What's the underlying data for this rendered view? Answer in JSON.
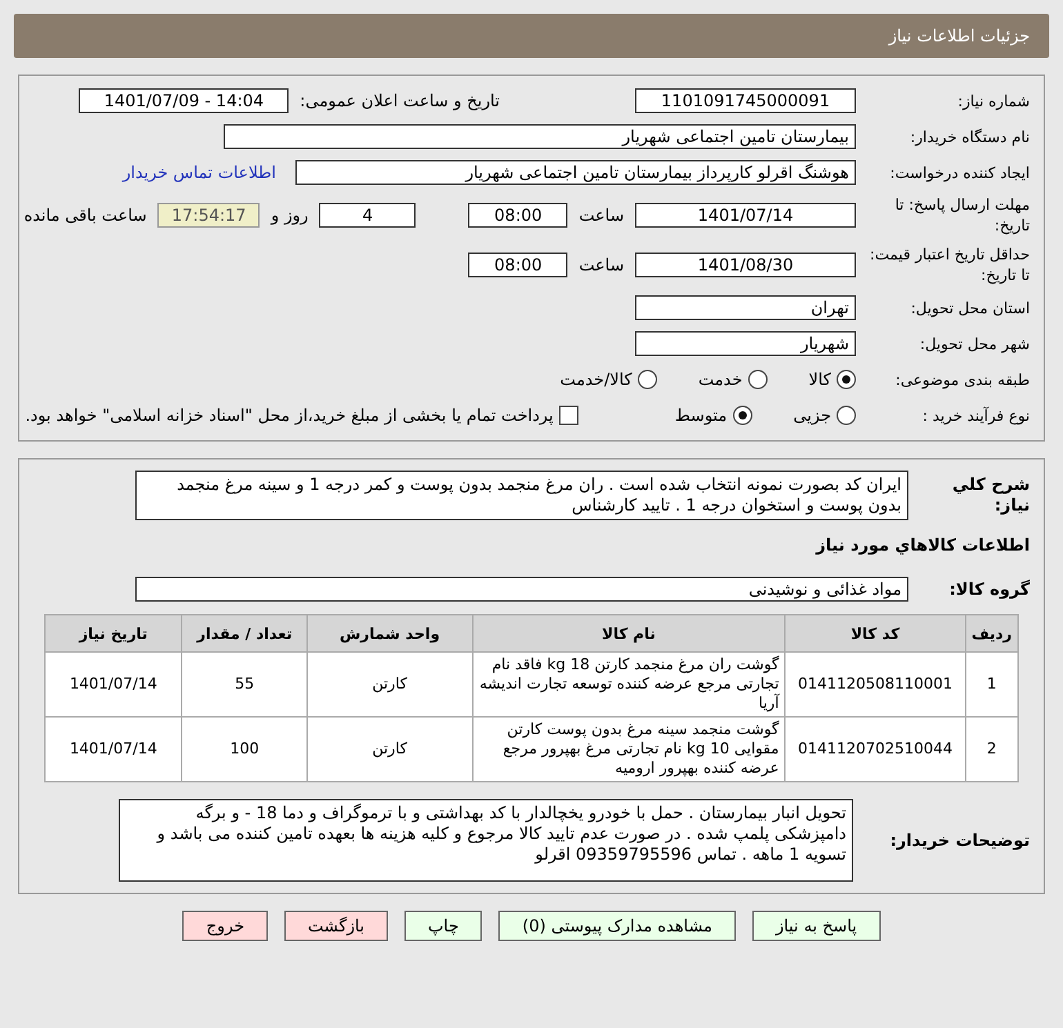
{
  "header": {
    "title": "جزئیات اطلاعات نیاز"
  },
  "need_number": {
    "label": "شماره نیاز:",
    "value": "1101091745000091"
  },
  "announce": {
    "label": "تاریخ و ساعت اعلان عمومی:",
    "value": "1401/07/09 - 14:04"
  },
  "buyer_org": {
    "label": "نام دستگاه خریدار:",
    "value": "بیمارستان تامین اجتماعی شهریار"
  },
  "requester": {
    "label": "ایجاد کننده درخواست:",
    "value": "هوشنگ اقرلو کارپرداز بیمارستان تامین اجتماعی شهریار",
    "link": "اطلاعات تماس خریدار"
  },
  "deadline": {
    "label": "مهلت ارسال پاسخ: تا تاریخ:",
    "date": "1401/07/14",
    "time_label": "ساعت",
    "time": "08:00",
    "days": "4",
    "days_label": "روز و",
    "remaining": "17:54:17",
    "remaining_label": "ساعت باقی مانده"
  },
  "validity": {
    "label": "حداقل تاریخ اعتبار قیمت: تا تاریخ:",
    "date": "1401/08/30",
    "time_label": "ساعت",
    "time": "08:00"
  },
  "province": {
    "label": "استان محل تحویل:",
    "value": "تهران"
  },
  "city": {
    "label": "شهر محل تحویل:",
    "value": "شهریار"
  },
  "category": {
    "label": "طبقه بندی موضوعی:",
    "options": [
      {
        "label": "کالا",
        "selected": true
      },
      {
        "label": "خدمت",
        "selected": false
      },
      {
        "label": "کالا/خدمت",
        "selected": false
      }
    ]
  },
  "process": {
    "label": "نوع فرآیند خرید :",
    "options": [
      {
        "label": "جزیی",
        "selected": false
      },
      {
        "label": "متوسط",
        "selected": true
      }
    ],
    "payment": {
      "label": "پرداخت تمام یا بخشی از مبلغ خرید،از محل \"اسناد خزانه اسلامی\" خواهد بود.",
      "checked": false
    }
  },
  "description": {
    "label": "شرح کلي نياز:",
    "text": "ایران کد بصورت نمونه انتخاب شده است . ران مرغ منجمد بدون پوست و کمر درجه 1 و سینه مرغ منجمد بدون پوست و استخوان درجه 1 . تایید کارشناس"
  },
  "goods_title": "اطلاعات کالاهاي مورد نياز",
  "goods_group": {
    "label": "گروه کالا:",
    "value": "مواد غذائی و نوشیدنی"
  },
  "table": {
    "columns": [
      "ردیف",
      "کد کالا",
      "نام کالا",
      "واحد شمارش",
      "تعداد / مقدار",
      "تاریخ نیاز"
    ],
    "rows": [
      [
        "1",
        "0141120508110001",
        "گوشت ران مرغ منجمد کارتن 18 kg فاقد نام تجارتی مرجع عرضه کننده توسعه تجارت اندیشه آریا",
        "کارتن",
        "55",
        "1401/07/14"
      ],
      [
        "2",
        "0141120702510044",
        "گوشت منجمد سینه مرغ بدون پوست کارتن مقوایی 10 kg نام تجارتی مرغ بهپرور مرجع عرضه کننده بهپرور ارومیه",
        "کارتن",
        "100",
        "1401/07/14"
      ]
    ]
  },
  "buyer_notes": {
    "label": "توضیحات خریدار:",
    "text": "تحویل انبار بیمارستان . حمل با خودرو یخچالدار  با کد بهداشتی و با ترموگراف و دما 18 - و برگه دامپزشکی پلمپ شده . در صورت عدم تایید کالا مرجوع و کلیه هزینه ها بعهده تامین کننده می باشد و تسویه 1 ماهه . تماس 09359795596 اقرلو"
  },
  "buttons": [
    {
      "label": "پاسخ به نیاز",
      "kind": "normal"
    },
    {
      "label": "مشاهده مدارک پیوستی (0)",
      "kind": "normal"
    },
    {
      "label": "چاپ",
      "kind": "normal"
    },
    {
      "label": "بازگشت",
      "kind": "danger"
    },
    {
      "label": "خروج",
      "kind": "danger"
    }
  ]
}
